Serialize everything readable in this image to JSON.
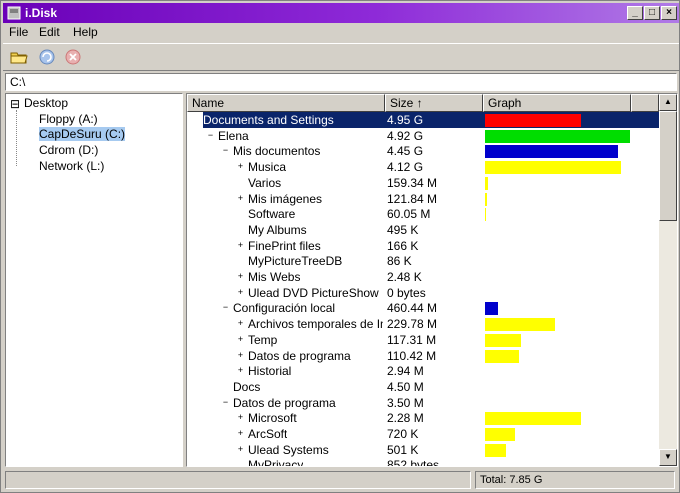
{
  "window": {
    "title": "i.Disk"
  },
  "menu": [
    "File",
    "Edit",
    "Help"
  ],
  "toolbar": {
    "buttons": [
      {
        "name": "open-folder-button",
        "icon": "folder-icon"
      },
      {
        "name": "refresh-button",
        "icon": "refresh-icon"
      },
      {
        "name": "stop-button",
        "icon": "stop-icon"
      }
    ]
  },
  "address": {
    "value": "C:\\"
  },
  "tree": {
    "root": {
      "label": "Desktop",
      "expander": "⊟"
    },
    "items": [
      {
        "label": "Floppy (A:)",
        "selected": false
      },
      {
        "label": "CapDeSuru (C:)",
        "selected": true
      },
      {
        "label": "Cdrom (D:)",
        "selected": false
      },
      {
        "label": "Network (L:)",
        "selected": false
      }
    ]
  },
  "list": {
    "columns": [
      "Name",
      "Size ↑",
      "Graph"
    ],
    "rows": [
      {
        "name": "Documents and Settings",
        "size": "4.95 G",
        "level": 0,
        "expander": "−",
        "bar_percent": 65,
        "bar_color": "#ff0000",
        "selected": true
      },
      {
        "name": "Elena",
        "size": "4.92 G",
        "level": 1,
        "expander": "−",
        "bar_percent": 98,
        "bar_color": "#00dd00"
      },
      {
        "name": "Mis documentos",
        "size": "4.45 G",
        "level": 2,
        "expander": "−",
        "bar_percent": 90,
        "bar_color": "#0000cc"
      },
      {
        "name": "Musica",
        "size": "4.12 G",
        "level": 3,
        "expander": "+",
        "bar_percent": 92,
        "bar_color": "#ffff00"
      },
      {
        "name": "Varios",
        "size": "159.34 M",
        "level": 3,
        "expander": "",
        "bar_percent": 2,
        "bar_color": "#ffff00"
      },
      {
        "name": "Mis imágenes",
        "size": "121.84 M",
        "level": 3,
        "expander": "+",
        "bar_percent": 1.5,
        "bar_color": "#ffff00"
      },
      {
        "name": "Software",
        "size": "60.05 M",
        "level": 3,
        "expander": "",
        "bar_percent": 1,
        "bar_color": "#ffff00"
      },
      {
        "name": "My Albums",
        "size": "495 K",
        "level": 3,
        "expander": "",
        "bar_percent": 0,
        "bar_color": "#ffff00"
      },
      {
        "name": "FinePrint files",
        "size": "166 K",
        "level": 3,
        "expander": "+",
        "bar_percent": 0,
        "bar_color": "#ffff00"
      },
      {
        "name": "MyPictureTreeDB",
        "size": "86 K",
        "level": 3,
        "expander": "",
        "bar_percent": 0,
        "bar_color": "#ffff00"
      },
      {
        "name": "Mis Webs",
        "size": "2.48 K",
        "level": 3,
        "expander": "+",
        "bar_percent": 0,
        "bar_color": "#ffff00"
      },
      {
        "name": "Ulead DVD PictureShow",
        "size": "0 bytes",
        "level": 3,
        "expander": "+",
        "bar_percent": 0,
        "bar_color": "#ffff00"
      },
      {
        "name": "Configuración local",
        "size": "460.44 M",
        "level": 2,
        "expander": "−",
        "bar_percent": 9,
        "bar_color": "#0000cc"
      },
      {
        "name": "Archivos temporales de Internet",
        "size": "229.78 M",
        "level": 3,
        "expander": "+",
        "bar_percent": 47,
        "bar_color": "#ffff00"
      },
      {
        "name": "Temp",
        "size": "117.31 M",
        "level": 3,
        "expander": "+",
        "bar_percent": 24,
        "bar_color": "#ffff00"
      },
      {
        "name": "Datos de programa",
        "size": "110.42 M",
        "level": 3,
        "expander": "+",
        "bar_percent": 23,
        "bar_color": "#ffff00"
      },
      {
        "name": "Historial",
        "size": "2.94 M",
        "level": 3,
        "expander": "+",
        "bar_percent": 0,
        "bar_color": "#ffff00"
      },
      {
        "name": "Docs",
        "size": "4.50 M",
        "level": 2,
        "expander": "",
        "bar_percent": 0,
        "bar_color": "#ffff00"
      },
      {
        "name": "Datos de programa",
        "size": "3.50 M",
        "level": 2,
        "expander": "−",
        "bar_percent": 0,
        "bar_color": "#ffff00"
      },
      {
        "name": "Microsoft",
        "size": "2.28 M",
        "level": 3,
        "expander": "+",
        "bar_percent": 65,
        "bar_color": "#ffff00"
      },
      {
        "name": "ArcSoft",
        "size": "720 K",
        "level": 3,
        "expander": "+",
        "bar_percent": 20,
        "bar_color": "#ffff00"
      },
      {
        "name": "Ulead Systems",
        "size": "501 K",
        "level": 3,
        "expander": "+",
        "bar_percent": 14,
        "bar_color": "#ffff00"
      },
      {
        "name": "MyPrivacy",
        "size": "852 bytes",
        "level": 3,
        "expander": "",
        "bar_percent": 0,
        "bar_color": "#ffff00"
      }
    ]
  },
  "status": {
    "left": "",
    "total": "Total: 7.85 G"
  }
}
